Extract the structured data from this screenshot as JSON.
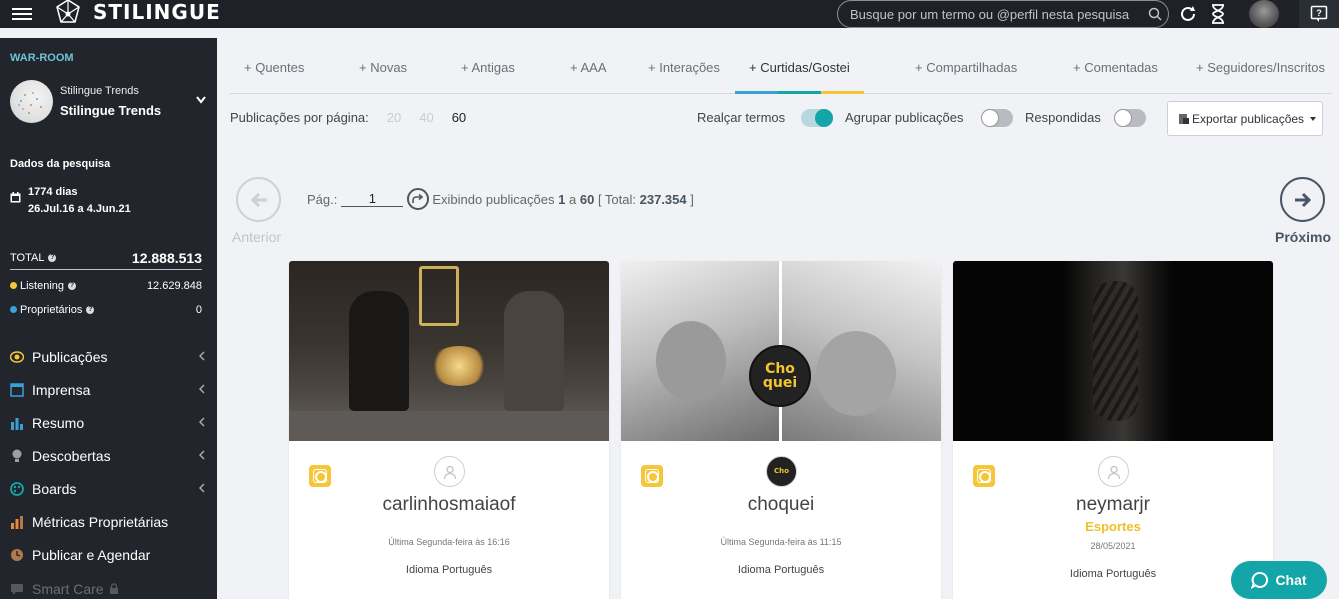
{
  "brand": {
    "name": "STILINGUE"
  },
  "search": {
    "placeholder": "Busque por um termo ou @perfil nesta pesquisa"
  },
  "sidebar": {
    "section": "WAR-ROOM",
    "profile": {
      "subtitle": "Stilingue Trends",
      "title": "Stilingue Trends"
    },
    "data_title": "Dados da pesquisa",
    "period": {
      "days": "1774 dias",
      "range": "26.Jul.16 a 4.Jun.21"
    },
    "total": {
      "label": "TOTAL",
      "value": "12.888.513"
    },
    "breakdown": [
      {
        "label": "Listening",
        "value": "12.629.848",
        "color": "#f5c63a"
      },
      {
        "label": "Proprietários",
        "value": "0",
        "color": "#3aa0d8"
      }
    ],
    "menu": [
      {
        "label": "Publicações",
        "icon": "eye-icon",
        "color": "#f5c63a"
      },
      {
        "label": "Imprensa",
        "icon": "newspaper-icon",
        "color": "#3aa0d8"
      },
      {
        "label": "Resumo",
        "icon": "bar-chart-icon",
        "color": "#3aa0d8"
      },
      {
        "label": "Descobertas",
        "icon": "bulb-icon",
        "color": "#9aa0a6"
      },
      {
        "label": "Boards",
        "icon": "palette-icon",
        "color": "#14a5a8"
      },
      {
        "label": "Métricas Proprietárias",
        "icon": "metrics-icon",
        "color": "#e58a3a"
      },
      {
        "label": "Publicar e Agendar",
        "icon": "clock-icon",
        "color": "#b07a4a"
      },
      {
        "label": "Smart Care",
        "icon": "chat-bubble-icon",
        "color": "#6a6f76"
      }
    ]
  },
  "tabs": [
    {
      "label": "+ Quentes"
    },
    {
      "label": "+ Novas"
    },
    {
      "label": "+ Antigas"
    },
    {
      "label": "+ AAA"
    },
    {
      "label": "+ Interações"
    },
    {
      "label": "+ Curtidas/Gostei"
    },
    {
      "label": "+ Compartilhadas"
    },
    {
      "label": "+ Comentadas"
    },
    {
      "label": "+ Seguidores/Inscritos"
    }
  ],
  "toolbar": {
    "per_page_label": "Publicações por página:",
    "per_page_options": [
      "20",
      "40",
      "60"
    ],
    "highlight_label": "Realçar termos",
    "group_label": "Agrupar publicações",
    "answered_label": "Respondidas",
    "export_label": "Exportar publicações"
  },
  "pagination": {
    "page_label": "Pág.:",
    "page_value": "1",
    "showing": "Exibindo publicações",
    "from": "1",
    "sep": "a",
    "to": "60",
    "total_open": "[ Total:",
    "total": "237.354",
    "total_close": "]",
    "prev_label": "Anterior",
    "next_label": "Próximo"
  },
  "cards": [
    {
      "name": "carlinhosmaiaof",
      "category": "",
      "date": "Última Segunda-feira às 16:16",
      "language": "Idioma Português"
    },
    {
      "name": "choquei",
      "category": "",
      "date": "Última Segunda-feira às 11:15",
      "language": "Idioma Português",
      "logo_line1": "Cho",
      "logo_line2": "quei"
    },
    {
      "name": "neymarjr",
      "category": "Esportes",
      "date": "28/05/2021",
      "language": "Idioma Português"
    }
  ],
  "chat": {
    "label": "Chat"
  }
}
